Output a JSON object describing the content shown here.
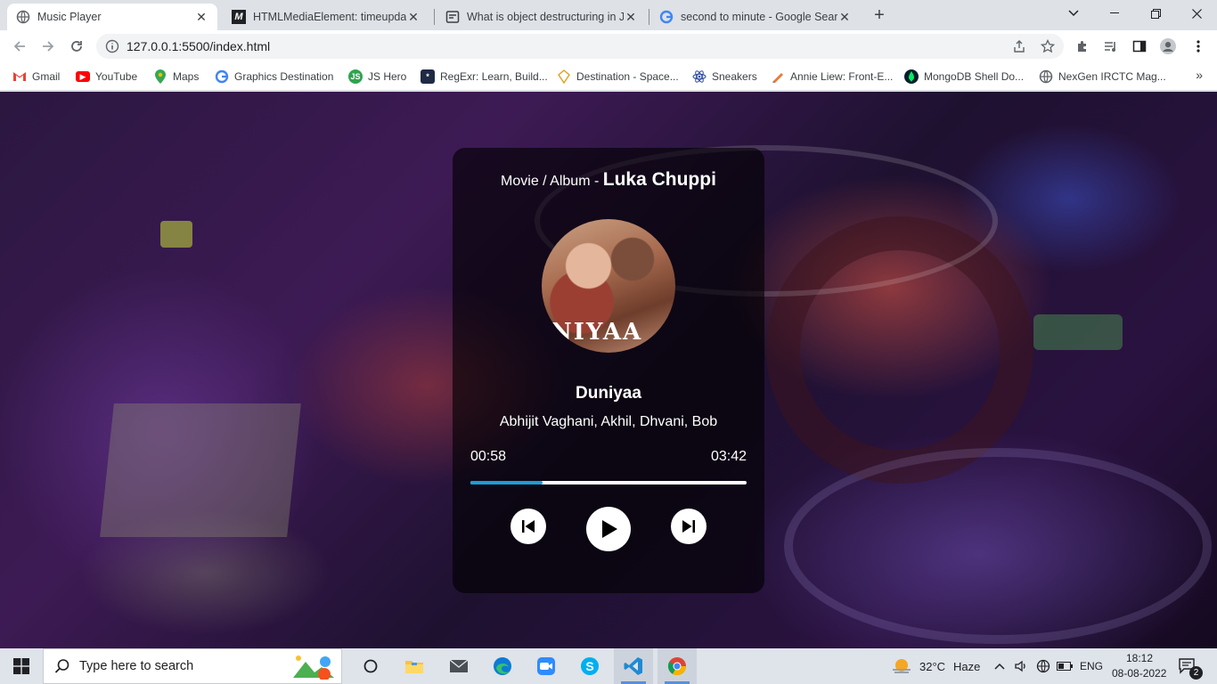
{
  "browser": {
    "tabs": [
      {
        "title": "Music Player",
        "active": true
      },
      {
        "title": "HTMLMediaElement: timeupdate",
        "active": false
      },
      {
        "title": "What is object destructuring in Ja",
        "active": false
      },
      {
        "title": "second to minute - Google Searc",
        "active": false
      }
    ],
    "url": "127.0.0.1:5500/index.html",
    "bookmarks": [
      {
        "label": "Gmail",
        "icon": "gmail-icon"
      },
      {
        "label": "YouTube",
        "icon": "youtube-icon"
      },
      {
        "label": "Maps",
        "icon": "maps-icon"
      },
      {
        "label": "Graphics Destination",
        "icon": "google-icon"
      },
      {
        "label": "JS Hero",
        "icon": "jshero-icon"
      },
      {
        "label": "RegExr: Learn, Build...",
        "icon": "regexr-icon"
      },
      {
        "label": "Destination - Space...",
        "icon": "space-icon"
      },
      {
        "label": "Sneakers",
        "icon": "react-icon"
      },
      {
        "label": "Annie Liew: Front-E...",
        "icon": "annie-icon"
      },
      {
        "label": "MongoDB Shell Do...",
        "icon": "mongodb-icon"
      },
      {
        "label": "NexGen IRCTC Mag...",
        "icon": "globe-icon"
      }
    ],
    "more_bookmarks": "»"
  },
  "player": {
    "album_prefix": "Movie / Album -",
    "album_name": "Luka Chuppi",
    "cover_text": "NIYAA",
    "song_title": "Duniyaa",
    "artists": "Abhijit Vaghani, Akhil, Dhvani, Bob",
    "current_time": "00:58",
    "duration": "03:42",
    "progress_fraction": 0.26,
    "accent_color": "#1e9bd7"
  },
  "taskbar": {
    "search_placeholder": "Type here to search",
    "weather_temp": "32°C",
    "weather_desc": "Haze",
    "language": "ENG",
    "time": "18:12",
    "date": "08-08-2022",
    "notification_count": "2"
  }
}
